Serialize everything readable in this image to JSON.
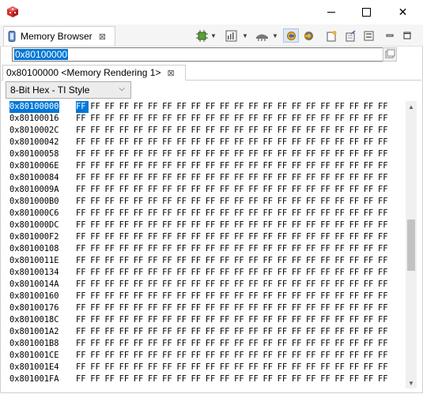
{
  "window": {
    "close_glyph": "✕"
  },
  "view_tab": {
    "label": "Memory Browser",
    "close_glyph": "⊠"
  },
  "toolbar": {
    "dropdown_glyph": "▼"
  },
  "address": {
    "value": "0x80100000"
  },
  "rendering_tab": {
    "label": "0x80100000 <Memory Rendering 1>",
    "close_glyph": "⊠"
  },
  "format": {
    "selected": "8-Bit Hex - TI Style",
    "chevron": "⌵"
  },
  "memory": {
    "byte_value": "FF",
    "bytes_per_row": 22,
    "rows": [
      "0x80100000",
      "0x80100016",
      "0x8010002C",
      "0x80100042",
      "0x80100058",
      "0x8010006E",
      "0x80100084",
      "0x8010009A",
      "0x801000B0",
      "0x801000C6",
      "0x801000DC",
      "0x801000F2",
      "0x80100108",
      "0x8010011E",
      "0x80100134",
      "0x8010014A",
      "0x80100160",
      "0x80100176",
      "0x8010018C",
      "0x801001A2",
      "0x801001B8",
      "0x801001CE",
      "0x801001E4",
      "0x801001FA"
    ]
  },
  "scrollbar": {
    "up_glyph": "▲",
    "down_glyph": "▼"
  },
  "colors": {
    "selection": "#0078d7",
    "app_icon": "#d0312d"
  }
}
